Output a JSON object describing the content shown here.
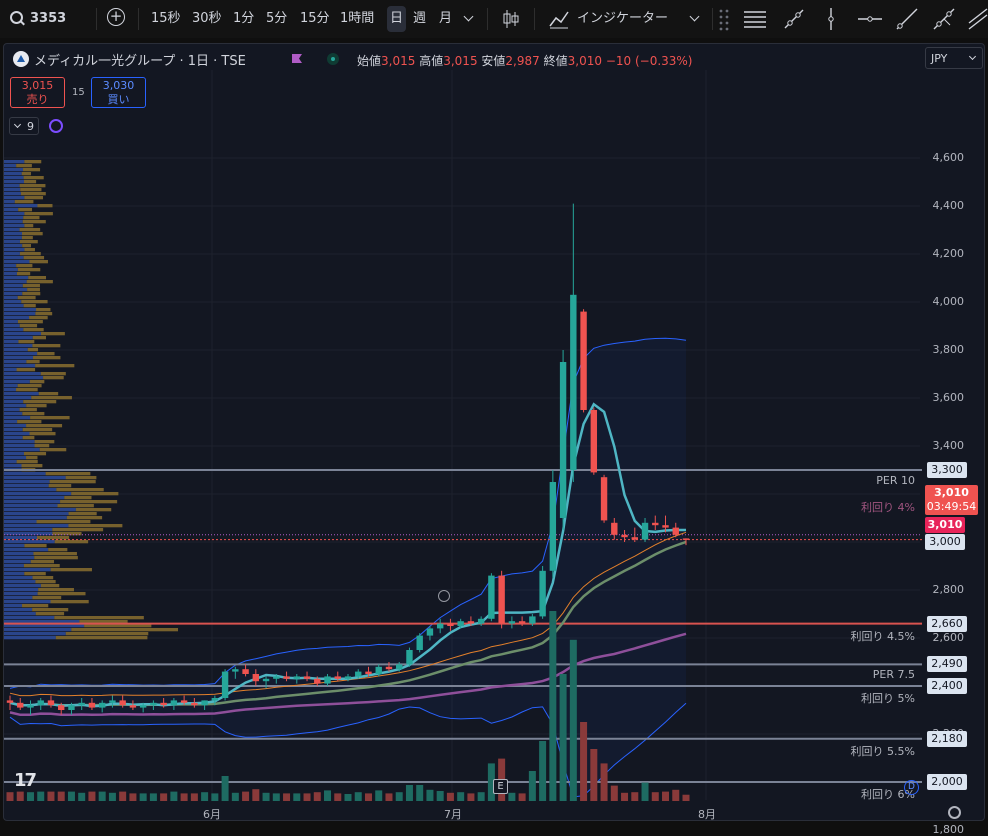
{
  "toolbar": {
    "symbol": "3353",
    "intervals": [
      "15秒",
      "30秒",
      "1分",
      "5分",
      "15分",
      "1時間",
      "日",
      "週",
      "月"
    ],
    "active_interval": "日",
    "indicators_label": "インジケーター"
  },
  "legend": {
    "title": "メディカル一光グループ · 1日 · TSE",
    "open_label": "始値",
    "open": "3,015",
    "high_label": "高値",
    "high": "3,015",
    "low_label": "安値",
    "low": "2,987",
    "close_label": "終値",
    "close": "3,010",
    "change": "−10 (−0.33%)"
  },
  "trade": {
    "sell_price": "3,015",
    "sell_label": "売り",
    "spread": "15",
    "buy_price": "3,030",
    "buy_label": "買い"
  },
  "indicator_count": "9",
  "currency": "JPY",
  "price_axis": [
    "4,600",
    "4,400",
    "4,200",
    "4,000",
    "3,800",
    "3,600",
    "3,400",
    "3,200",
    "3,000",
    "2,800",
    "2,600",
    "2,400",
    "2,200",
    "2,000",
    "1,800"
  ],
  "hlines": [
    {
      "price": 3300,
      "label": "PER 10",
      "tag": "3,300"
    },
    {
      "price": 2660,
      "label": "利回り 4.5%",
      "tag": "2,660"
    },
    {
      "price": 2490,
      "label": "PER 7.5",
      "tag": "2,490"
    },
    {
      "price": 2400,
      "label": "利回り 5%",
      "tag": "2,400"
    },
    {
      "price": 2180,
      "label": "利回り 5.5%",
      "tag": "2,180"
    },
    {
      "price": 2000,
      "label": "利回り 6%",
      "tag": "2,000"
    }
  ],
  "yield4_label": "利回り 4%",
  "current": {
    "price": "3,010",
    "countdown": "03:49:54",
    "tag2": "3,010",
    "tag3": "3,000"
  },
  "time_axis": [
    "6月",
    "7月",
    "8月"
  ],
  "event_marker": "E",
  "dividend_marker": "D",
  "colors": {
    "up": "#26a69a",
    "down": "#ef5350",
    "accent": "#2962ff"
  },
  "chart_data": {
    "type": "candlestick",
    "y_axis": {
      "min": 1750,
      "max": 4700
    },
    "candles": [
      {
        "o": 2340,
        "h": 2360,
        "l": 2300,
        "c": 2330
      },
      {
        "o": 2330,
        "h": 2350,
        "l": 2300,
        "c": 2310
      },
      {
        "o": 2310,
        "h": 2340,
        "l": 2280,
        "c": 2320
      },
      {
        "o": 2320,
        "h": 2350,
        "l": 2300,
        "c": 2340
      },
      {
        "o": 2340,
        "h": 2360,
        "l": 2310,
        "c": 2320
      },
      {
        "o": 2320,
        "h": 2330,
        "l": 2280,
        "c": 2300
      },
      {
        "o": 2300,
        "h": 2330,
        "l": 2280,
        "c": 2320
      },
      {
        "o": 2320,
        "h": 2350,
        "l": 2300,
        "c": 2330
      },
      {
        "o": 2330,
        "h": 2350,
        "l": 2300,
        "c": 2310
      },
      {
        "o": 2310,
        "h": 2340,
        "l": 2290,
        "c": 2330
      },
      {
        "o": 2330,
        "h": 2360,
        "l": 2310,
        "c": 2340
      },
      {
        "o": 2340,
        "h": 2360,
        "l": 2310,
        "c": 2320
      },
      {
        "o": 2320,
        "h": 2340,
        "l": 2300,
        "c": 2310
      },
      {
        "o": 2310,
        "h": 2330,
        "l": 2290,
        "c": 2320
      },
      {
        "o": 2320,
        "h": 2340,
        "l": 2300,
        "c": 2330
      },
      {
        "o": 2330,
        "h": 2350,
        "l": 2310,
        "c": 2320
      },
      {
        "o": 2320,
        "h": 2350,
        "l": 2300,
        "c": 2340
      },
      {
        "o": 2340,
        "h": 2360,
        "l": 2320,
        "c": 2330
      },
      {
        "o": 2330,
        "h": 2350,
        "l": 2310,
        "c": 2320
      },
      {
        "o": 2320,
        "h": 2340,
        "l": 2300,
        "c": 2340
      },
      {
        "o": 2340,
        "h": 2360,
        "l": 2320,
        "c": 2350
      },
      {
        "o": 2350,
        "h": 2470,
        "l": 2340,
        "c": 2460
      },
      {
        "o": 2460,
        "h": 2480,
        "l": 2430,
        "c": 2470
      },
      {
        "o": 2470,
        "h": 2490,
        "l": 2440,
        "c": 2450
      },
      {
        "o": 2450,
        "h": 2470,
        "l": 2400,
        "c": 2420
      },
      {
        "o": 2420,
        "h": 2440,
        "l": 2390,
        "c": 2430
      },
      {
        "o": 2430,
        "h": 2450,
        "l": 2410,
        "c": 2440
      },
      {
        "o": 2440,
        "h": 2460,
        "l": 2420,
        "c": 2430
      },
      {
        "o": 2430,
        "h": 2450,
        "l": 2410,
        "c": 2440
      },
      {
        "o": 2440,
        "h": 2460,
        "l": 2420,
        "c": 2430
      },
      {
        "o": 2430,
        "h": 2440,
        "l": 2400,
        "c": 2410
      },
      {
        "o": 2410,
        "h": 2450,
        "l": 2400,
        "c": 2440
      },
      {
        "o": 2440,
        "h": 2460,
        "l": 2420,
        "c": 2430
      },
      {
        "o": 2430,
        "h": 2450,
        "l": 2420,
        "c": 2440
      },
      {
        "o": 2440,
        "h": 2470,
        "l": 2430,
        "c": 2460
      },
      {
        "o": 2460,
        "h": 2480,
        "l": 2440,
        "c": 2450
      },
      {
        "o": 2450,
        "h": 2490,
        "l": 2440,
        "c": 2480
      },
      {
        "o": 2480,
        "h": 2500,
        "l": 2460,
        "c": 2470
      },
      {
        "o": 2470,
        "h": 2500,
        "l": 2460,
        "c": 2490
      },
      {
        "o": 2490,
        "h": 2560,
        "l": 2480,
        "c": 2550
      },
      {
        "o": 2550,
        "h": 2620,
        "l": 2540,
        "c": 2610
      },
      {
        "o": 2610,
        "h": 2650,
        "l": 2590,
        "c": 2640
      },
      {
        "o": 2640,
        "h": 2680,
        "l": 2620,
        "c": 2660
      },
      {
        "o": 2660,
        "h": 2680,
        "l": 2630,
        "c": 2650
      },
      {
        "o": 2650,
        "h": 2680,
        "l": 2640,
        "c": 2670
      },
      {
        "o": 2670,
        "h": 2690,
        "l": 2650,
        "c": 2660
      },
      {
        "o": 2660,
        "h": 2690,
        "l": 2650,
        "c": 2680
      },
      {
        "o": 2680,
        "h": 2870,
        "l": 2670,
        "c": 2860
      },
      {
        "o": 2860,
        "h": 2880,
        "l": 2640,
        "c": 2660
      },
      {
        "o": 2660,
        "h": 2690,
        "l": 2640,
        "c": 2670
      },
      {
        "o": 2670,
        "h": 2690,
        "l": 2650,
        "c": 2660
      },
      {
        "o": 2660,
        "h": 2700,
        "l": 2650,
        "c": 2690
      },
      {
        "o": 2690,
        "h": 2900,
        "l": 2680,
        "c": 2880
      },
      {
        "o": 2880,
        "h": 3300,
        "l": 2850,
        "c": 3250
      },
      {
        "o": 3100,
        "h": 3800,
        "l": 3050,
        "c": 3750
      },
      {
        "o": 3300,
        "h": 4410,
        "l": 3250,
        "c": 4030
      },
      {
        "o": 3960,
        "h": 3970,
        "l": 3540,
        "c": 3550
      },
      {
        "o": 3550,
        "h": 3560,
        "l": 3280,
        "c": 3290
      },
      {
        "o": 3270,
        "h": 3280,
        "l": 3080,
        "c": 3090
      },
      {
        "o": 3080,
        "h": 3100,
        "l": 3010,
        "c": 3030
      },
      {
        "o": 3030,
        "h": 3050,
        "l": 3000,
        "c": 3020
      },
      {
        "o": 3020,
        "h": 3060,
        "l": 3000,
        "c": 3010
      },
      {
        "o": 3010,
        "h": 3100,
        "l": 3000,
        "c": 3080
      },
      {
        "o": 3080,
        "h": 3110,
        "l": 3050,
        "c": 3070
      },
      {
        "o": 3070,
        "h": 3110,
        "l": 3040,
        "c": 3060
      },
      {
        "o": 3060,
        "h": 3080,
        "l": 3020,
        "c": 3030
      },
      {
        "o": 3015,
        "h": 3015,
        "l": 2987,
        "c": 3010
      }
    ]
  }
}
